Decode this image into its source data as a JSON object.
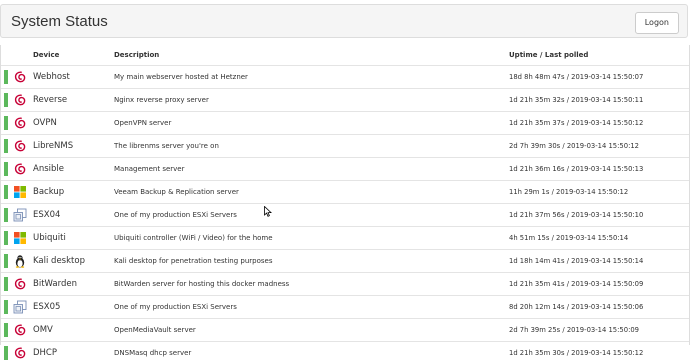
{
  "header": {
    "title": "System Status",
    "logon_label": "Logon"
  },
  "table": {
    "columns": {
      "device": "Device",
      "description": "Description",
      "uptime": "Uptime / Last polled"
    },
    "rows": [
      {
        "device": "Webhost",
        "icon": "debian-icon",
        "description": "My main webserver hosted at Hetzner",
        "uptime": "18d 8h 48m 47s / 2019-03-14 15:50:07"
      },
      {
        "device": "Reverse",
        "icon": "debian-icon",
        "description": "Nginx reverse proxy server",
        "uptime": "1d 21h 35m 32s / 2019-03-14 15:50:11"
      },
      {
        "device": "OVPN",
        "icon": "debian-icon",
        "description": "OpenVPN server",
        "uptime": "1d 21h 35m 37s / 2019-03-14 15:50:12"
      },
      {
        "device": "LibreNMS",
        "icon": "debian-icon",
        "description": "The librenms server you're on",
        "uptime": "2d 7h 39m 30s / 2019-03-14 15:50:12"
      },
      {
        "device": "Ansible",
        "icon": "debian-icon",
        "description": "Management server",
        "uptime": "1d 21h 36m 16s / 2019-03-14 15:50:13"
      },
      {
        "device": "Backup",
        "icon": "windows-icon",
        "description": "Veeam Backup & Replication server",
        "uptime": "11h 29m 1s / 2019-03-14 15:50:12"
      },
      {
        "device": "ESX04",
        "icon": "vmware-icon",
        "description": "One of my production ESXi Servers",
        "uptime": "1d 21h 37m 56s / 2019-03-14 15:50:10"
      },
      {
        "device": "Ubiquiti",
        "icon": "windows-icon",
        "description": "Ubiquiti controller (WiFi / Video) for the home",
        "uptime": "4h 51m 15s / 2019-03-14 15:50:14"
      },
      {
        "device": "Kali desktop",
        "icon": "linux-icon",
        "description": "Kali desktop for penetration testing purposes",
        "uptime": "1d 18h 14m 41s / 2019-03-14 15:50:14"
      },
      {
        "device": "BitWarden",
        "icon": "debian-icon",
        "description": "BitWarden server for hosting this docker madness",
        "uptime": "1d 21h 35m 41s / 2019-03-14 15:50:09"
      },
      {
        "device": "ESX05",
        "icon": "vmware-icon",
        "description": "One of my production ESXi Servers",
        "uptime": "8d 20h 12m 14s / 2019-03-14 15:50:06"
      },
      {
        "device": "OMV",
        "icon": "debian-icon",
        "description": "OpenMediaVault server",
        "uptime": "2d 7h 39m 25s / 2019-03-14 15:50:09"
      },
      {
        "device": "DHCP",
        "icon": "debian-icon",
        "description": "DNSMasq dhcp server",
        "uptime": "1d 21h 35m 30s / 2019-03-14 15:50:12"
      }
    ]
  },
  "colors": {
    "status_up": "#5cb85c",
    "debian": "#c70036",
    "header_bg": "#f5f5f5"
  }
}
